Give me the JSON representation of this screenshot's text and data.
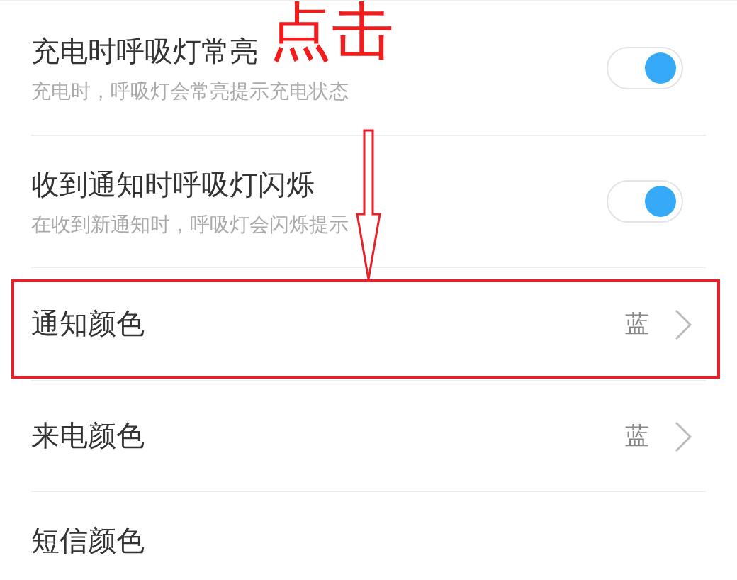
{
  "rows": [
    {
      "kind": "toggle",
      "title": "充电时呼吸灯常亮",
      "subtitle": "充电时，呼吸灯会常亮提示充电状态",
      "on": true,
      "highlighted": false
    },
    {
      "kind": "toggle",
      "title": "收到通知时呼吸灯闪烁",
      "subtitle": "在收到新通知时，呼吸灯会闪烁提示",
      "on": true,
      "highlighted": false
    },
    {
      "kind": "link",
      "title": "通知颜色",
      "value": "蓝",
      "highlighted": true
    },
    {
      "kind": "link",
      "title": "来电颜色",
      "value": "蓝",
      "highlighted": false
    },
    {
      "kind": "plain",
      "title": "短信颜色",
      "highlighted": false
    }
  ],
  "annotation": {
    "label": "点击"
  }
}
